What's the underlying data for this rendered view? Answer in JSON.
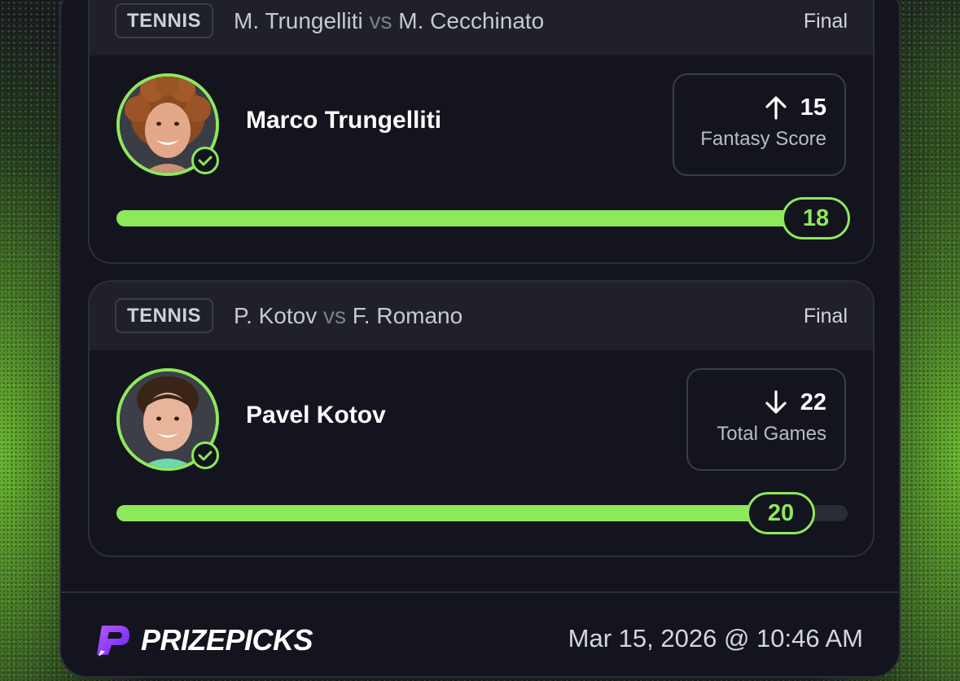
{
  "picks": [
    {
      "sport": "TENNIS",
      "matchup": {
        "player_a": "M. Trungelliti",
        "vs": "vs",
        "player_b": "M. Cecchinato"
      },
      "status": "Final",
      "player_name": "Marco Trungelliti",
      "stat": {
        "direction": "up",
        "line": "15",
        "label": "Fantasy Score"
      },
      "result": "18",
      "progress": 1.0
    },
    {
      "sport": "TENNIS",
      "matchup": {
        "player_a": "P. Kotov",
        "vs": "vs",
        "player_b": "F. Romano"
      },
      "status": "Final",
      "player_name": "Pavel Kotov",
      "stat": {
        "direction": "down",
        "line": "22",
        "label": "Total Games"
      },
      "result": "20",
      "progress": 0.909
    }
  ],
  "footer": {
    "brand": "PRIZEPICKS",
    "timestamp": "Mar 15, 2026 @ 10:46 AM"
  },
  "colors": {
    "accent": "#8ee85c",
    "card_bg": "#13141d",
    "header_bg": "#1f2029",
    "brand_purple": "#8a3cff"
  },
  "icons": [
    "arrow-up-icon",
    "arrow-down-icon",
    "check-circle-icon",
    "prizepicks-logo"
  ]
}
